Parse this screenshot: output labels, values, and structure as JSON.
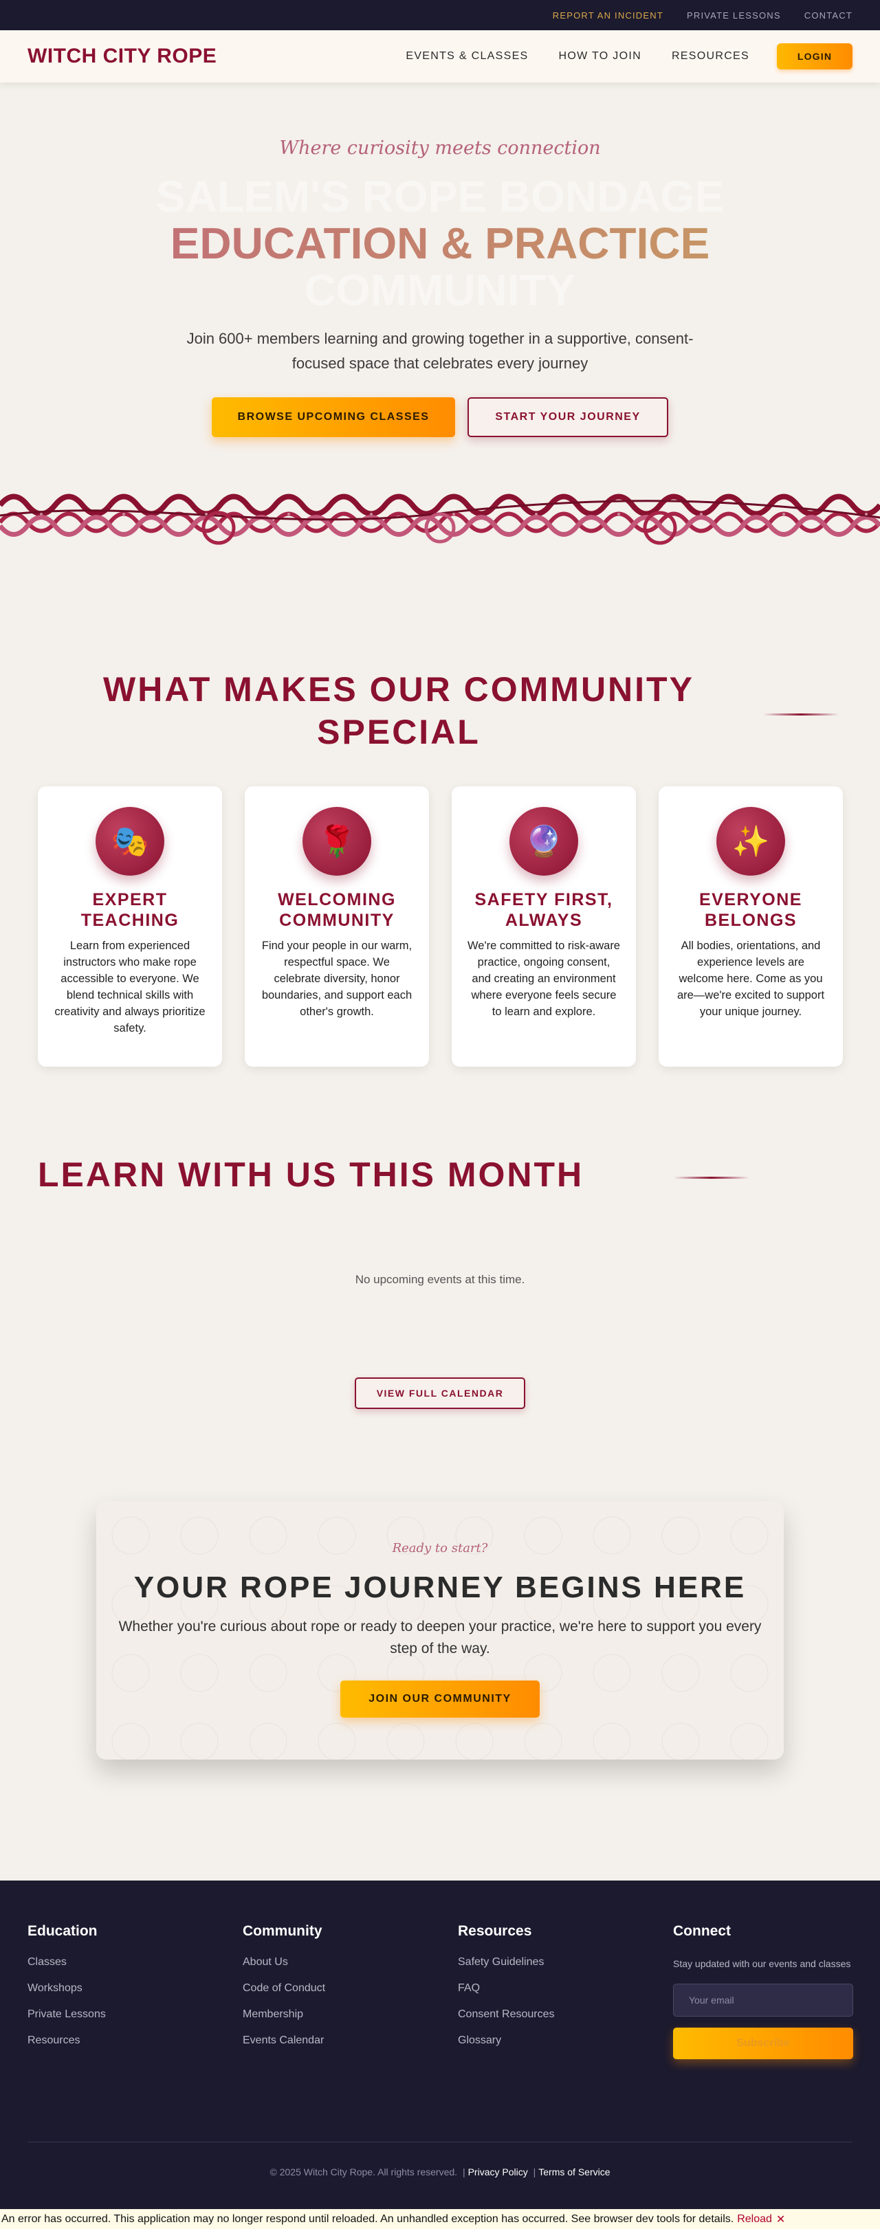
{
  "utility_nav": [
    {
      "label": "REPORT AN INCIDENT"
    },
    {
      "label": "PRIVATE LESSONS"
    },
    {
      "label": "CONTACT"
    }
  ],
  "header": {
    "logo": "WITCH CITY ROPE",
    "nav": [
      {
        "label": "EVENTS & CLASSES"
      },
      {
        "label": "HOW TO JOIN"
      },
      {
        "label": "RESOURCES"
      }
    ],
    "login_label": "LOGIN"
  },
  "hero": {
    "tagline": "Where curiosity meets connection",
    "title_line1": "SALEM'S ROPE BONDAGE",
    "title_line2": "EDUCATION & PRACTICE",
    "title_line3": "COMMUNITY",
    "subtitle": "Join 600+ members learning and growing together in a supportive, consent-focused space that celebrates every journey",
    "primary_cta": "BROWSE UPCOMING CLASSES",
    "secondary_cta": "START YOUR JOURNEY"
  },
  "features": {
    "heading": "WHAT MAKES OUR COMMUNITY SPECIAL",
    "cards": [
      {
        "icon": "🎭",
        "icon_name": "theater-masks-icon",
        "title": "EXPERT TEACHING",
        "text": "Learn from experienced instructors who make rope accessible to everyone. We blend technical skills with creativity and always prioritize safety."
      },
      {
        "icon": "🌹",
        "icon_name": "rose-icon",
        "title": "WELCOMING COMMUNITY",
        "text": "Find your people in our warm, respectful space. We celebrate diversity, honor boundaries, and support each other's growth."
      },
      {
        "icon": "🔮",
        "icon_name": "crystal-ball-icon",
        "title": "SAFETY FIRST, ALWAYS",
        "text": "We're committed to risk-aware practice, ongoing consent, and creating an environment where everyone feels secure to learn and explore."
      },
      {
        "icon": "✨",
        "icon_name": "sparkles-icon",
        "title": "EVERYONE BELONGS",
        "text": "All bodies, orientations, and experience levels are welcome here. Come as you are—we're excited to support your unique journey."
      }
    ]
  },
  "events": {
    "heading": "LEARN WITH US THIS MONTH",
    "empty_message": "No upcoming events at this time.",
    "calendar_cta": "VIEW FULL CALENDAR"
  },
  "cta": {
    "kicker": "Ready to start?",
    "title": "YOUR ROPE JOURNEY BEGINS HERE",
    "text": "Whether you're curious about rope or ready to deepen your practice, we're here to support you every step of the way.",
    "button": "JOIN OUR COMMUNITY"
  },
  "footer": {
    "columns": [
      {
        "heading": "Education",
        "links": [
          "Classes",
          "Workshops",
          "Private Lessons",
          "Resources"
        ]
      },
      {
        "heading": "Community",
        "links": [
          "About Us",
          "Code of Conduct",
          "Membership",
          "Events Calendar"
        ]
      },
      {
        "heading": "Resources",
        "links": [
          "Safety Guidelines",
          "FAQ",
          "Consent Resources",
          "Glossary"
        ]
      }
    ],
    "connect": {
      "heading": "Connect",
      "text": "Stay updated with our events and classes",
      "email_placeholder": "Your email",
      "subscribe_label": "Subscribe"
    },
    "copyright": "© 2025 Witch City Rope. All rights reserved.",
    "separator": "|",
    "legal_links": [
      "Privacy Policy",
      "Terms of Service"
    ]
  },
  "error_bar": {
    "message": "An error has occurred. This application may no longer respond until reloaded. An unhandled exception has occurred. See browser dev tools for details.",
    "reload_label": "Reload",
    "dismiss_label": "✕"
  },
  "colors": {
    "brand": "#8a1130",
    "accent": "#ff9f00",
    "dark": "#1c1a2e",
    "background": "#f4f0eb"
  }
}
